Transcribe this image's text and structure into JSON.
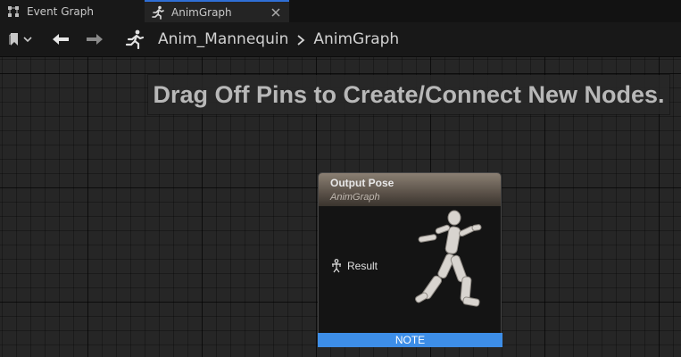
{
  "tabs": [
    {
      "label": "Event Graph",
      "icon": "event-graph-icon",
      "active": false
    },
    {
      "label": "AnimGraph",
      "icon": "running-person-icon",
      "active": true
    }
  ],
  "toolbar": {
    "bookmark_icon": "bookmark-icon",
    "back_icon": "arrow-left-icon",
    "forward_icon": "arrow-right-icon",
    "breadcrumb_icon": "running-person-icon"
  },
  "breadcrumb": [
    "Anim_Mannequin",
    "AnimGraph"
  ],
  "graph": {
    "hint": "Drag Off Pins to Create/Connect New Nodes.",
    "node": {
      "title": "Output Pose",
      "subtitle": "AnimGraph",
      "pin_label": "Result",
      "pin_icon": "pose-pin-icon"
    },
    "note_label": "NOTE"
  },
  "colors": {
    "accent": "#2f6fd6",
    "note": "#3d8ee8",
    "background": "#262626"
  }
}
